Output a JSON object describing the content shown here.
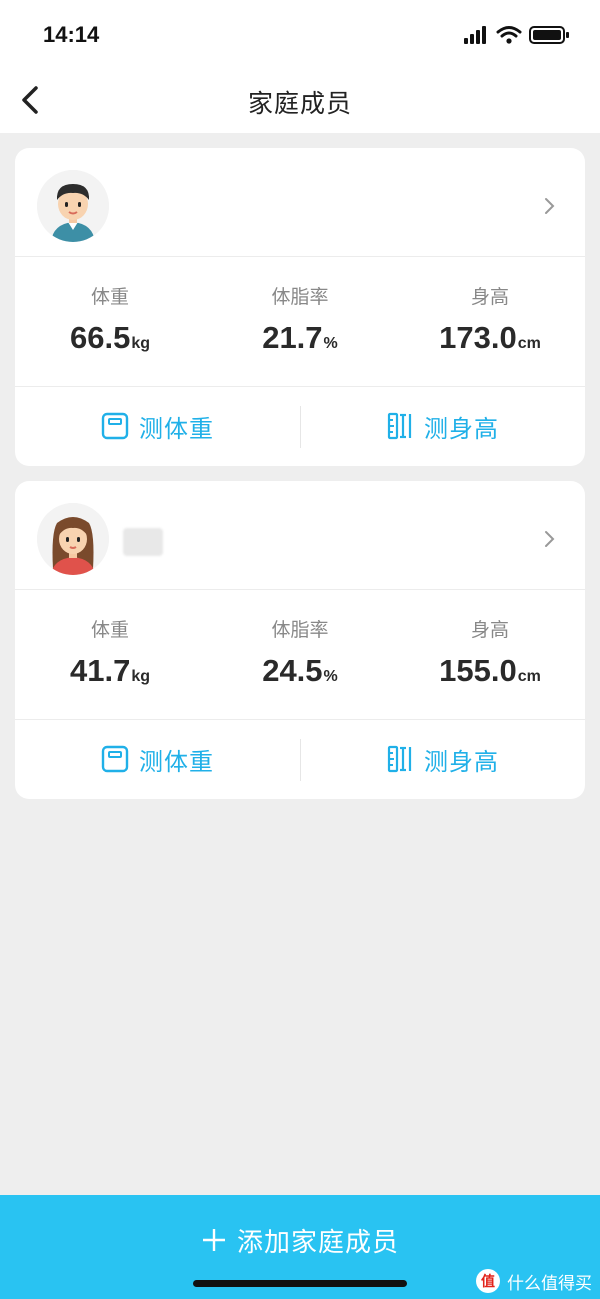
{
  "status_bar": {
    "time": "14:14"
  },
  "nav": {
    "title": "家庭成员"
  },
  "members": [
    {
      "stats": [
        {
          "label": "体重",
          "value": "66.5",
          "unit": "kg"
        },
        {
          "label": "体脂率",
          "value": "21.7",
          "unit": "%"
        },
        {
          "label": "身高",
          "value": "173.0",
          "unit": "cm"
        }
      ],
      "actions": [
        {
          "label": "测体重",
          "icon": "scale-icon"
        },
        {
          "label": "测身高",
          "icon": "ruler-icon"
        }
      ]
    },
    {
      "stats": [
        {
          "label": "体重",
          "value": "41.7",
          "unit": "kg"
        },
        {
          "label": "体脂率",
          "value": "24.5",
          "unit": "%"
        },
        {
          "label": "身高",
          "value": "155.0",
          "unit": "cm"
        }
      ],
      "actions": [
        {
          "label": "测体重",
          "icon": "scale-icon"
        },
        {
          "label": "测身高",
          "icon": "ruler-icon"
        }
      ]
    }
  ],
  "bottom": {
    "add_label": "添加家庭成员",
    "icon": "plus-icon"
  },
  "watermark": {
    "text": "什么值得买"
  },
  "colors": {
    "accent": "#20b0e8",
    "bottom_bar": "#29c3f2",
    "background": "#eeeeee"
  }
}
